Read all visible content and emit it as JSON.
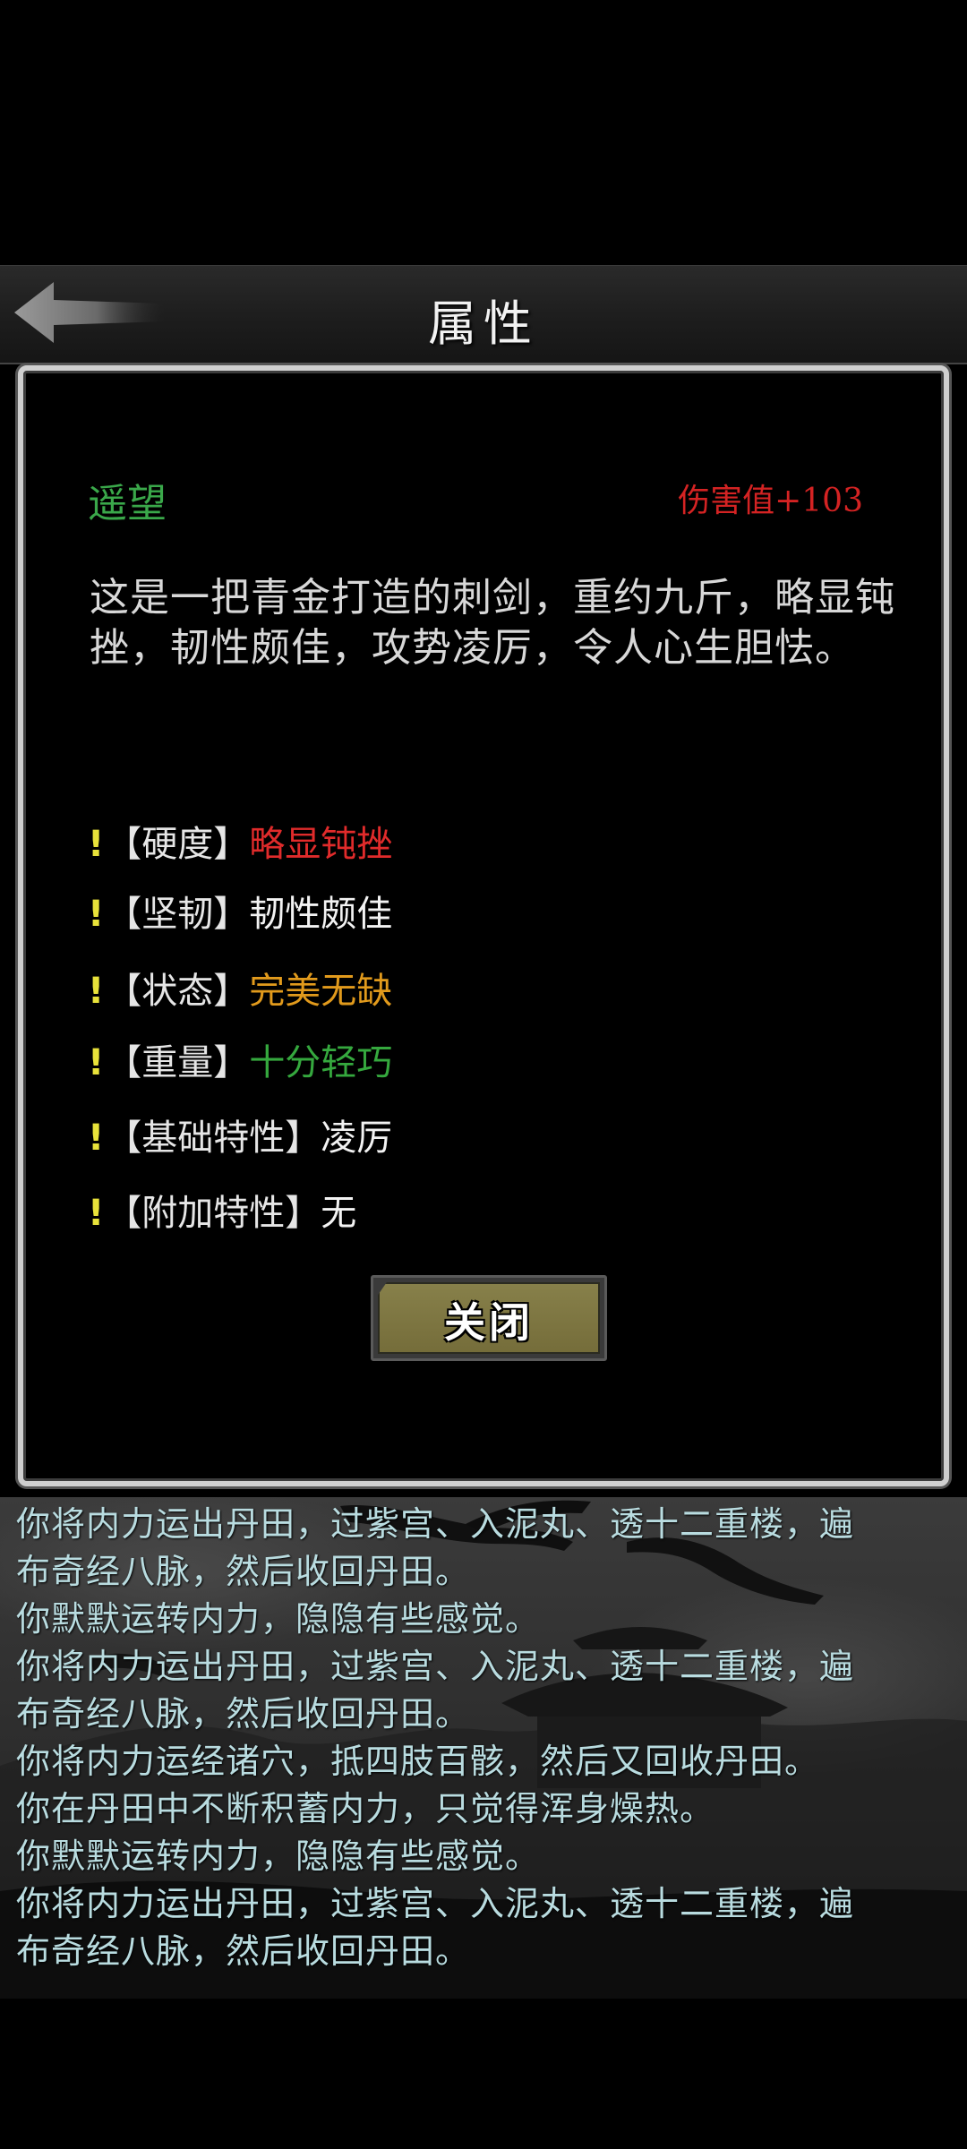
{
  "header": {
    "title": "属性"
  },
  "item": {
    "name": "遥望",
    "damage": "伤害值+103",
    "description": "这是一把青金打造的刺剑，重约九斤，略显钝挫，韧性颇佳，攻势凌厉，令人心生胆怯。",
    "name_color": "#3aa84a",
    "damage_color": "#d42323"
  },
  "attributes": [
    {
      "marker": "!",
      "label": "【硬度】",
      "value": "略显钝挫",
      "color": "#e02b2b"
    },
    {
      "marker": "!",
      "label": "【坚韧】",
      "value": "韧性颇佳",
      "color": "#f3f3f3"
    },
    {
      "marker": "!",
      "label": "【状态】",
      "value": "完美无缺",
      "color": "#e19a1c"
    },
    {
      "marker": "!",
      "label": "【重量】",
      "value": "十分轻巧",
      "color": "#35a83e"
    },
    {
      "marker": "!",
      "label": "【基础特性】",
      "value": "凌厉",
      "color": "#f3f3f3"
    },
    {
      "marker": "!",
      "label": "【附加特性】",
      "value": "无",
      "color": "#f3f3f3"
    }
  ],
  "close_button": {
    "label": "关闭"
  },
  "log": [
    "你将内力运出丹田，过紫宫、入泥丸、透十二重楼，遍",
    "布奇经八脉，然后收回丹田。",
    "你默默运转内力，隐隐有些感觉。",
    "你将内力运出丹田，过紫宫、入泥丸、透十二重楼，遍",
    "布奇经八脉，然后收回丹田。",
    "你将内力运经诸穴，抵四肢百骸，然后又回收丹田。",
    "你在丹田中不断积蓄内力，只觉得浑身燥热。",
    "你默默运转内力，隐隐有些感觉。",
    "你将内力运出丹田，过紫宫、入泥丸、透十二重楼，遍",
    "布奇经八脉，然后收回丹田。"
  ],
  "icons": {
    "back": "back-arrow-icon"
  }
}
